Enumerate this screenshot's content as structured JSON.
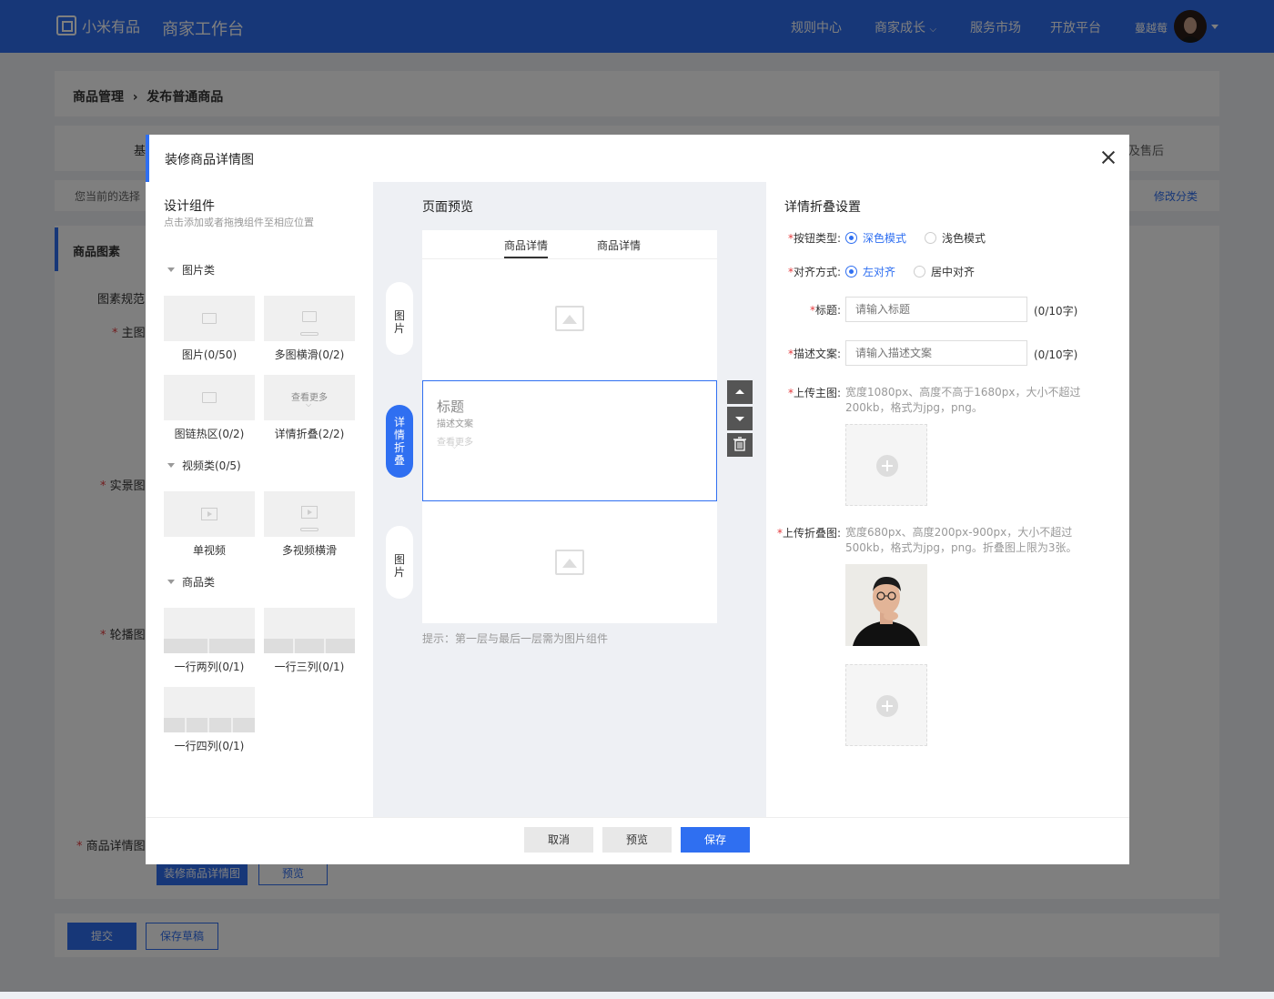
{
  "topbar": {
    "logo_text": "小米有品",
    "app_title": "商家工作台",
    "nav": [
      "规则中心",
      "商家成长",
      "服务市场",
      "开放平台"
    ],
    "user_name": "蔓越莓"
  },
  "background": {
    "breadcrumb_1": "商品管理",
    "breadcrumb_2": "发布普通商品",
    "tab_left": "基",
    "tab_right": "及售后",
    "current_choice": "您当前的选择",
    "modify_category": "修改分类",
    "section_title": "商品图素",
    "spec_label": "图素规范",
    "main_image_label": "主图",
    "real_image_label": "实景图",
    "carousel_label": "轮播图",
    "detail_image_label": "商品详情图",
    "decorate_button": "装修商品详情图",
    "preview_button": "预览",
    "submit_button": "提交",
    "save_draft_button": "保存草稿"
  },
  "modal": {
    "title": "装修商品详情图",
    "left": {
      "title": "设计组件",
      "subtitle": "点击添加或者拖拽组件至相应位置",
      "groups": [
        {
          "label": "图片类",
          "items": [
            "图片(0/50)",
            "多图横滑(0/2)",
            "图链热区(0/2)",
            "详情折叠(2/2)"
          ]
        },
        {
          "label": "视频类(0/5)",
          "items": [
            "单视频",
            "多视频横滑"
          ]
        },
        {
          "label": "商品类",
          "items": [
            "一行两列(0/1)",
            "一行三列(0/1)",
            "一行四列(0/1)"
          ]
        }
      ],
      "fold_thumb_text": "查看更多"
    },
    "middle": {
      "title": "页面预览",
      "tabs": [
        "商品详情",
        "商品详情"
      ],
      "pills": [
        "图片",
        "详情折叠",
        "图片"
      ],
      "fold_title": "标题",
      "fold_desc": "描述文案",
      "fold_more": "查看更多",
      "tip": "提示：第一层与最后一层需为图片组件"
    },
    "right": {
      "title": "详情折叠设置",
      "button_type_label": "按钮类型:",
      "button_type_options": [
        "深色模式",
        "浅色模式"
      ],
      "align_label": "对齐方式:",
      "align_options": [
        "左对齐",
        "居中对齐"
      ],
      "title_label": "标题:",
      "title_placeholder": "请输入标题",
      "title_count": "(0/10字)",
      "desc_label": "描述文案:",
      "desc_placeholder": "请输入描述文案",
      "desc_count": "(0/10字)",
      "main_upload_label": "上传主图:",
      "main_upload_hint": "宽度1080px、高度不高于1680px，大小不超过200kb，格式为jpg，png。",
      "fold_upload_label": "上传折叠图:",
      "fold_upload_hint": "宽度680px、高度200px-900px，大小不超过500kb，格式为jpg，png。折叠图上限为3张。"
    },
    "footer": {
      "cancel": "取消",
      "preview": "预览",
      "save": "保存"
    }
  },
  "colors": {
    "primary": "#2f6ff1",
    "required": "#e4393c"
  }
}
